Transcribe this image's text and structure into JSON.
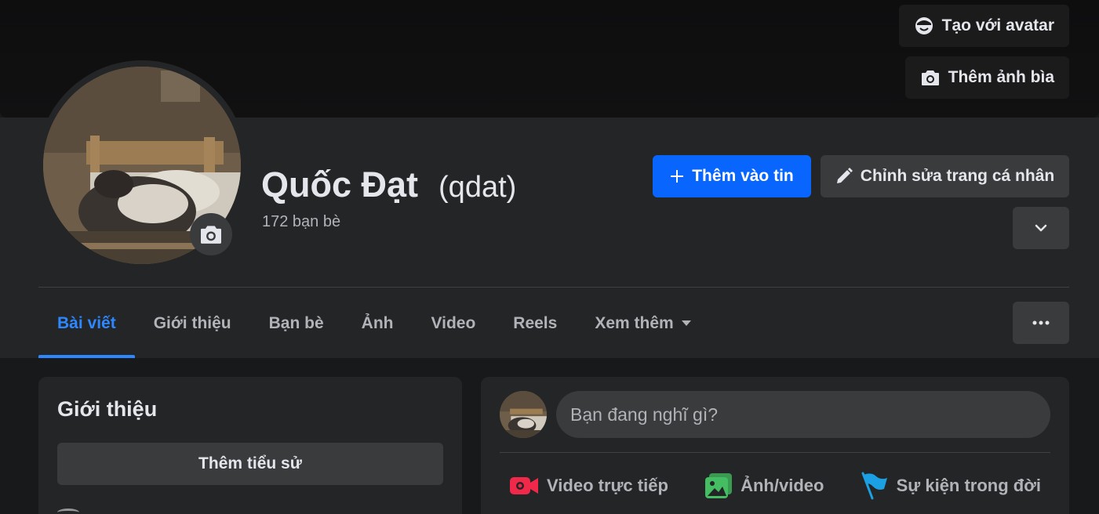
{
  "cover": {
    "avatar_button_label": "Tạo với avatar",
    "cover_photo_button_label": "Thêm ảnh bìa"
  },
  "profile": {
    "name": "Quốc Đạt",
    "alternate_name": "(qdat)",
    "friends_count": "172 bạn bè"
  },
  "actions": {
    "add_story_label": "Thêm vào tin",
    "edit_profile_label": "Chỉnh sửa trang cá nhân"
  },
  "tabs": [
    {
      "label": "Bài viết",
      "active": true
    },
    {
      "label": "Giới thiệu"
    },
    {
      "label": "Bạn bè"
    },
    {
      "label": "Ảnh"
    },
    {
      "label": "Video"
    },
    {
      "label": "Reels"
    },
    {
      "label": "Xem thêm"
    }
  ],
  "intro": {
    "title": "Giới thiệu",
    "add_bio_label": "Thêm tiểu sử"
  },
  "composer": {
    "placeholder": "Bạn đang nghĩ gì?",
    "actions": [
      {
        "label": "Video trực tiếp",
        "icon": "live-video-icon",
        "color": "#f02849"
      },
      {
        "label": "Ảnh/video",
        "icon": "photo-icon",
        "color": "#45bd62"
      },
      {
        "label": "Sự kiện trong đời",
        "icon": "flag-icon",
        "color": "#1ba0e4"
      }
    ]
  },
  "colors": {
    "primary": "#0866ff",
    "active_tab": "#2d88ff",
    "card": "#242526",
    "background": "#18191a"
  }
}
